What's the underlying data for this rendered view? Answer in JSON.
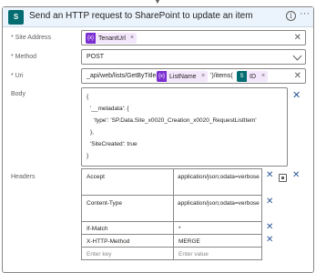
{
  "card": {
    "title": "Send an HTTP request to SharePoint to update an item"
  },
  "fields": {
    "site_address": {
      "label": "* Site Address",
      "token": "TenantUrl",
      "token_icon": "{x}"
    },
    "method": {
      "label": "* Method",
      "value": "POST"
    },
    "uri": {
      "label": "* Uri",
      "prefix": "_api/web/lists/GetByTitle('",
      "token1": "ListName",
      "token1_icon": "{x}",
      "middle": "')/items(",
      "token2": "ID",
      "token2_icon": "S"
    },
    "body": {
      "label": "Body",
      "lines": [
        "{",
        "  '__metadata': {",
        "    'type': 'SP.Data.Site_x0020_Creation_x0020_RequestListItem'",
        "  },",
        "  'SiteCreated': true",
        "}"
      ]
    },
    "headers": {
      "label": "Headers",
      "rows": [
        {
          "key": "Accept",
          "value": "application/json;odata=verbose"
        },
        {
          "key": "Content-Type",
          "value": "application/json;odata=verbose"
        },
        {
          "key": "If-Match",
          "value": "*"
        },
        {
          "key": "X-HTTP-Method",
          "value": "MERGE"
        }
      ],
      "key_placeholder": "Enter key",
      "value_placeholder": "Enter value"
    }
  },
  "icons": {
    "connector": "sharepoint-icon",
    "info": "info-icon",
    "more": "more-icon",
    "delete": "close-icon",
    "switch": "switch-mode-icon"
  },
  "colors": {
    "header_bg": "#ebf3fc",
    "variable_token": "#7b2dd1",
    "sharepoint_token": "#036c70"
  }
}
